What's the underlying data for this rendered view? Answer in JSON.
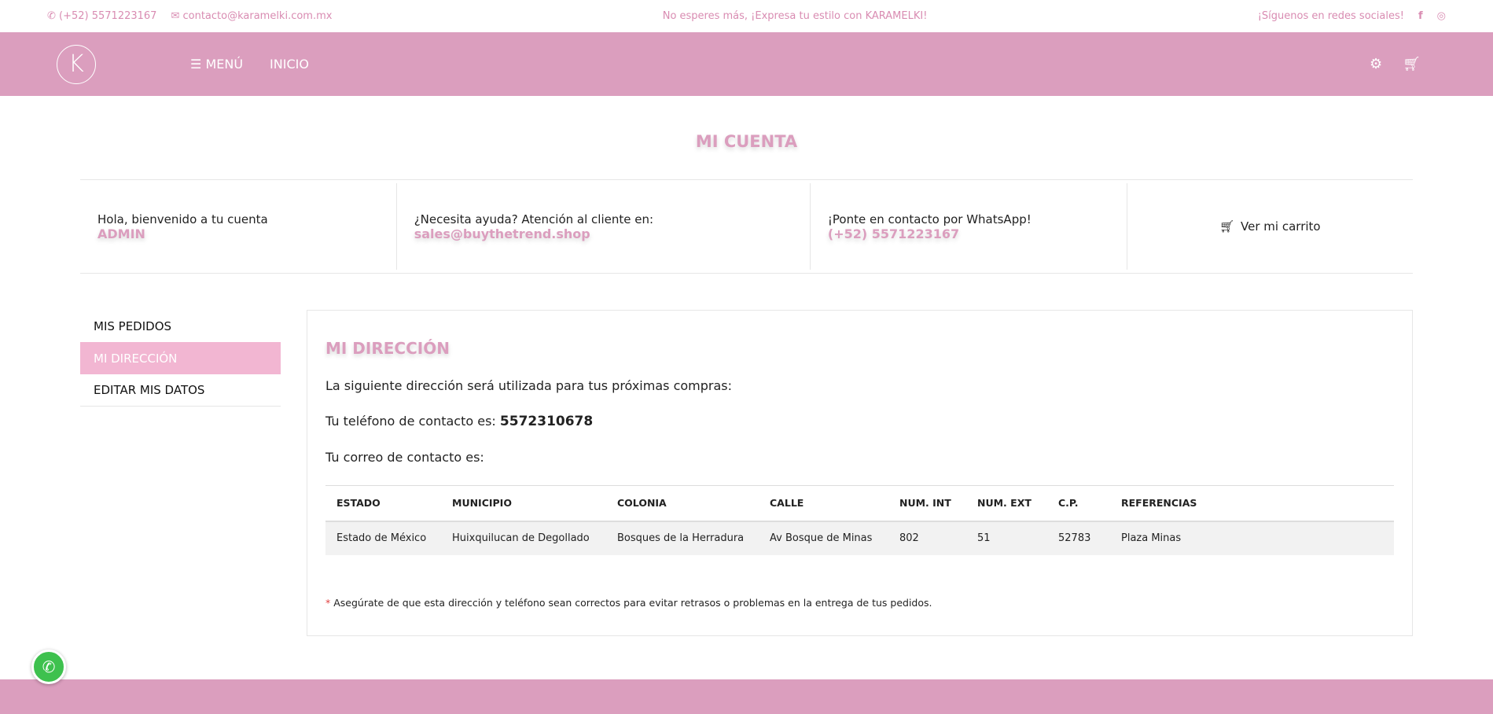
{
  "topbar": {
    "phone": "(+52) 5571223167",
    "email": "contacto@karamelki.com.mx",
    "promo": "No esperes más, ¡Expresa tu estilo con KARAMELKI!",
    "social": "¡Síguenos en redes sociales!"
  },
  "nav": {
    "logo": "K",
    "menu": "MENÚ",
    "home": "INICIO"
  },
  "page_title": "MI CUENTA",
  "info": {
    "welcome": "Hola, bienvenido a tu cuenta",
    "user": "ADMIN",
    "help": "¿Necesita ayuda? Atención al cliente en:",
    "help_email": "sales@buythetrend.shop",
    "whatsapp": "¡Ponte en contacto por WhatsApp!",
    "whatsapp_phone": "(+52) 5571223167",
    "cart": "Ver mi carrito"
  },
  "sidebar": {
    "items": [
      {
        "label": "MIS PEDIDOS"
      },
      {
        "label": "MI DIRECCIÓN"
      },
      {
        "label": "EDITAR MIS DATOS"
      }
    ]
  },
  "main": {
    "heading": "MI DIRECCIÓN",
    "intro": "La siguiente dirección será utilizada para tus próximas compras:",
    "phone_label": "Tu teléfono de contacto es:",
    "phone": "5572310678",
    "email_label": "Tu correo de contacto es:",
    "columns": [
      "ESTADO",
      "MUNICIPIO",
      "COLONIA",
      "CALLE",
      "NUM. INT",
      "NUM. EXT",
      "C.P.",
      "REFERENCIAS"
    ],
    "row": [
      "Estado de México",
      "Huixquilucan de Degollado",
      "Bosques de la Herradura",
      "Av Bosque de Minas",
      "802",
      "51",
      "52783",
      "Plaza Minas"
    ],
    "note_mark": "*",
    "note": "Asegúrate de que esta dirección y teléfono sean correctos para evitar retrasos o problemas en la entrega de tus pedidos."
  },
  "colors": {
    "brand": "#db9ebe",
    "active": "#f2b6d2"
  }
}
